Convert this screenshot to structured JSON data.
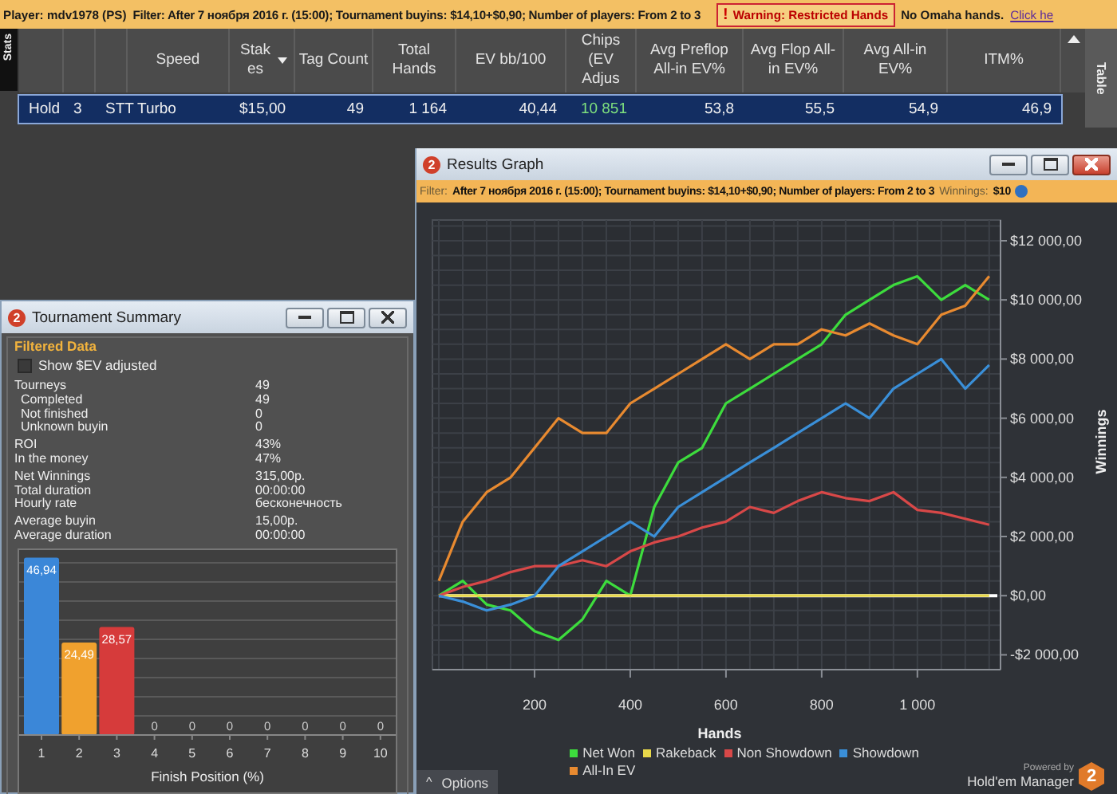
{
  "top_bar": {
    "player": "Player: mdv1978 (PS)",
    "filter": "Filter: After 7 ноября 2016 г. (15:00); Tournament buyins: $14,10+$0,90; Number of players: From 2 to 3",
    "warning_mark": "!",
    "warning": "Warning: Restricted Hands",
    "note": "No Omaha hands.",
    "link": "Click he"
  },
  "side_tabs": {
    "left": "Stats",
    "right": "Table"
  },
  "table": {
    "columns": [
      {
        "sorted": false
      },
      {
        "sorted": false
      },
      {
        "sorted": false
      },
      {
        "label": "Speed",
        "sorted": false
      },
      {
        "label": "Stakes",
        "sorted": true
      },
      {
        "label": "Tag Count",
        "sorted": false
      },
      {
        "label": "Total Hands",
        "sorted": false
      },
      {
        "label": "EV bb/100",
        "sorted": false
      },
      {
        "label": "Chips (EV Adjus",
        "sorted": false
      },
      {
        "label": "Avg Preflop All-in EV%",
        "sorted": false
      },
      {
        "label": "Avg Flop All-in EV%",
        "sorted": false
      },
      {
        "label": "Avg All-in EV%",
        "sorted": false
      },
      {
        "label": "ITM%",
        "sorted": false
      }
    ],
    "rows": [
      {
        "selected": true,
        "cells": [
          {
            "text": "Hold"
          },
          {
            "text": "3"
          },
          {
            "text": "STT"
          },
          {
            "text": "Turbo"
          },
          {
            "text": "$15,00"
          },
          {
            "text": "49"
          },
          {
            "text": "1 164"
          },
          {
            "text": "40,44"
          },
          {
            "text": "10 851",
            "color": "#7ee07e"
          },
          {
            "text": "53,8"
          },
          {
            "text": "55,5"
          },
          {
            "text": "54,9"
          },
          {
            "text": "46,9"
          }
        ]
      }
    ]
  },
  "summary_window": {
    "icon_label": "2",
    "title": "Tournament Summary",
    "group_title": "Filtered Data",
    "checkbox": {
      "label": "Show $EV adjusted",
      "checked": false
    },
    "stat_groups": [
      [
        {
          "label": "Tourneys",
          "value": "49",
          "children": [
            {
              "label": "Completed",
              "value": "49"
            },
            {
              "label": "Not finished",
              "value": "0"
            },
            {
              "label": "Unknown buyin",
              "value": "0"
            }
          ]
        }
      ],
      [
        {
          "label": "ROI",
          "value": "43%"
        },
        {
          "label": "In the money",
          "value": "47%"
        }
      ],
      [
        {
          "label": "Net Winnings",
          "value": "315,00р."
        },
        {
          "label": "Total duration",
          "value": "00:00:00"
        },
        {
          "label": "Hourly rate",
          "value": "бесконечность"
        }
      ],
      [
        {
          "label": "Average buyin",
          "value": "15,00р."
        },
        {
          "label": "Average duration",
          "value": "00:00:00"
        }
      ]
    ],
    "chart_data": {
      "type": "bar",
      "xlabel": "Finish Position (%)",
      "categories": [
        "1",
        "2",
        "3",
        "4",
        "5",
        "6",
        "7",
        "8",
        "9",
        "10"
      ],
      "values": [
        46.94,
        24.49,
        28.57,
        0,
        0,
        0,
        0,
        0,
        0,
        0
      ],
      "grid": true,
      "value_labels": [
        "46,94",
        "24,49",
        "28,57",
        "0",
        "0",
        "0",
        "0",
        "0",
        "0",
        "0"
      ],
      "data_labels": true
    }
  },
  "graph_window": {
    "icon_label": "2",
    "title": "Results Graph",
    "filter_label": "Filter:",
    "filter": "After 7 ноября 2016 г. (15:00); Tournament buyins: $14,10+$0,90; Number of players: From 2 to 3",
    "winnings_label": "Winnings:",
    "winnings": "$10",
    "chart_data": {
      "type": "line",
      "xlabel": "Hands",
      "ylabel": "Winnings",
      "x": [
        0,
        50,
        100,
        150,
        200,
        250,
        300,
        350,
        400,
        450,
        500,
        550,
        600,
        650,
        700,
        750,
        800,
        850,
        900,
        950,
        1000,
        1050,
        1100,
        1150
      ],
      "series": [
        {
          "name": "Net Won",
          "color": "#3ddc3d",
          "values": [
            0,
            500,
            -300,
            -500,
            -1200,
            -1500,
            -800,
            500,
            0,
            3000,
            4500,
            5000,
            6500,
            7000,
            7500,
            8000,
            8500,
            9500,
            10000,
            10500,
            10800,
            10000,
            10500,
            10000
          ]
        },
        {
          "name": "Rakeback",
          "color": "#e8d84a",
          "values": [
            0,
            0,
            0,
            0,
            0,
            0,
            0,
            0,
            0,
            0,
            0,
            0,
            0,
            0,
            0,
            0,
            0,
            0,
            0,
            0,
            0,
            0,
            0,
            0
          ]
        },
        {
          "name": "Non Showdown",
          "color": "#d84848",
          "values": [
            0,
            300,
            500,
            800,
            1000,
            1000,
            1200,
            1000,
            1500,
            1800,
            2000,
            2300,
            2500,
            3000,
            2800,
            3200,
            3500,
            3300,
            3200,
            3500,
            2900,
            2800,
            2600,
            2400
          ]
        },
        {
          "name": "Showdown",
          "color": "#3a8fd8",
          "values": [
            0,
            -200,
            -500,
            -300,
            0,
            1000,
            1500,
            2000,
            2500,
            2000,
            3000,
            3500,
            4000,
            4500,
            5000,
            5500,
            6000,
            6500,
            6000,
            7000,
            7500,
            8000,
            7000,
            7800
          ]
        },
        {
          "name": "All-In EV",
          "color": "#e88a30",
          "values": [
            500,
            2500,
            3500,
            4000,
            5000,
            6000,
            5500,
            5500,
            6500,
            7000,
            7500,
            8000,
            8500,
            8000,
            8500,
            8500,
            9000,
            8800,
            9200,
            8800,
            8500,
            9500,
            9800,
            10800
          ]
        }
      ],
      "xlim": [
        0,
        1167
      ],
      "ylim": [
        -2500,
        12700
      ],
      "grid": true,
      "xticks": [
        {
          "value": 200,
          "label": "200"
        },
        {
          "value": 400,
          "label": "400"
        },
        {
          "value": 600,
          "label": "600"
        },
        {
          "value": 800,
          "label": "800"
        },
        {
          "value": 1000,
          "label": "1 000"
        }
      ],
      "yticks": [
        {
          "value": -2000,
          "label": "-$2 000,00"
        },
        {
          "value": 0,
          "label": "$0,00"
        },
        {
          "value": 2000,
          "label": "$2 000,00"
        },
        {
          "value": 4000,
          "label": "$4 000,00"
        },
        {
          "value": 6000,
          "label": "$6 000,00"
        },
        {
          "value": 8000,
          "label": "$8 000,00"
        },
        {
          "value": 10000,
          "label": "$10 000,00"
        },
        {
          "value": 12000,
          "label": "$12 000,00"
        }
      ]
    },
    "options_caret": "^",
    "options": "Options",
    "powered_by": "Powered by",
    "brand": "Hold'em Manager",
    "brand_icon_label": "2"
  }
}
